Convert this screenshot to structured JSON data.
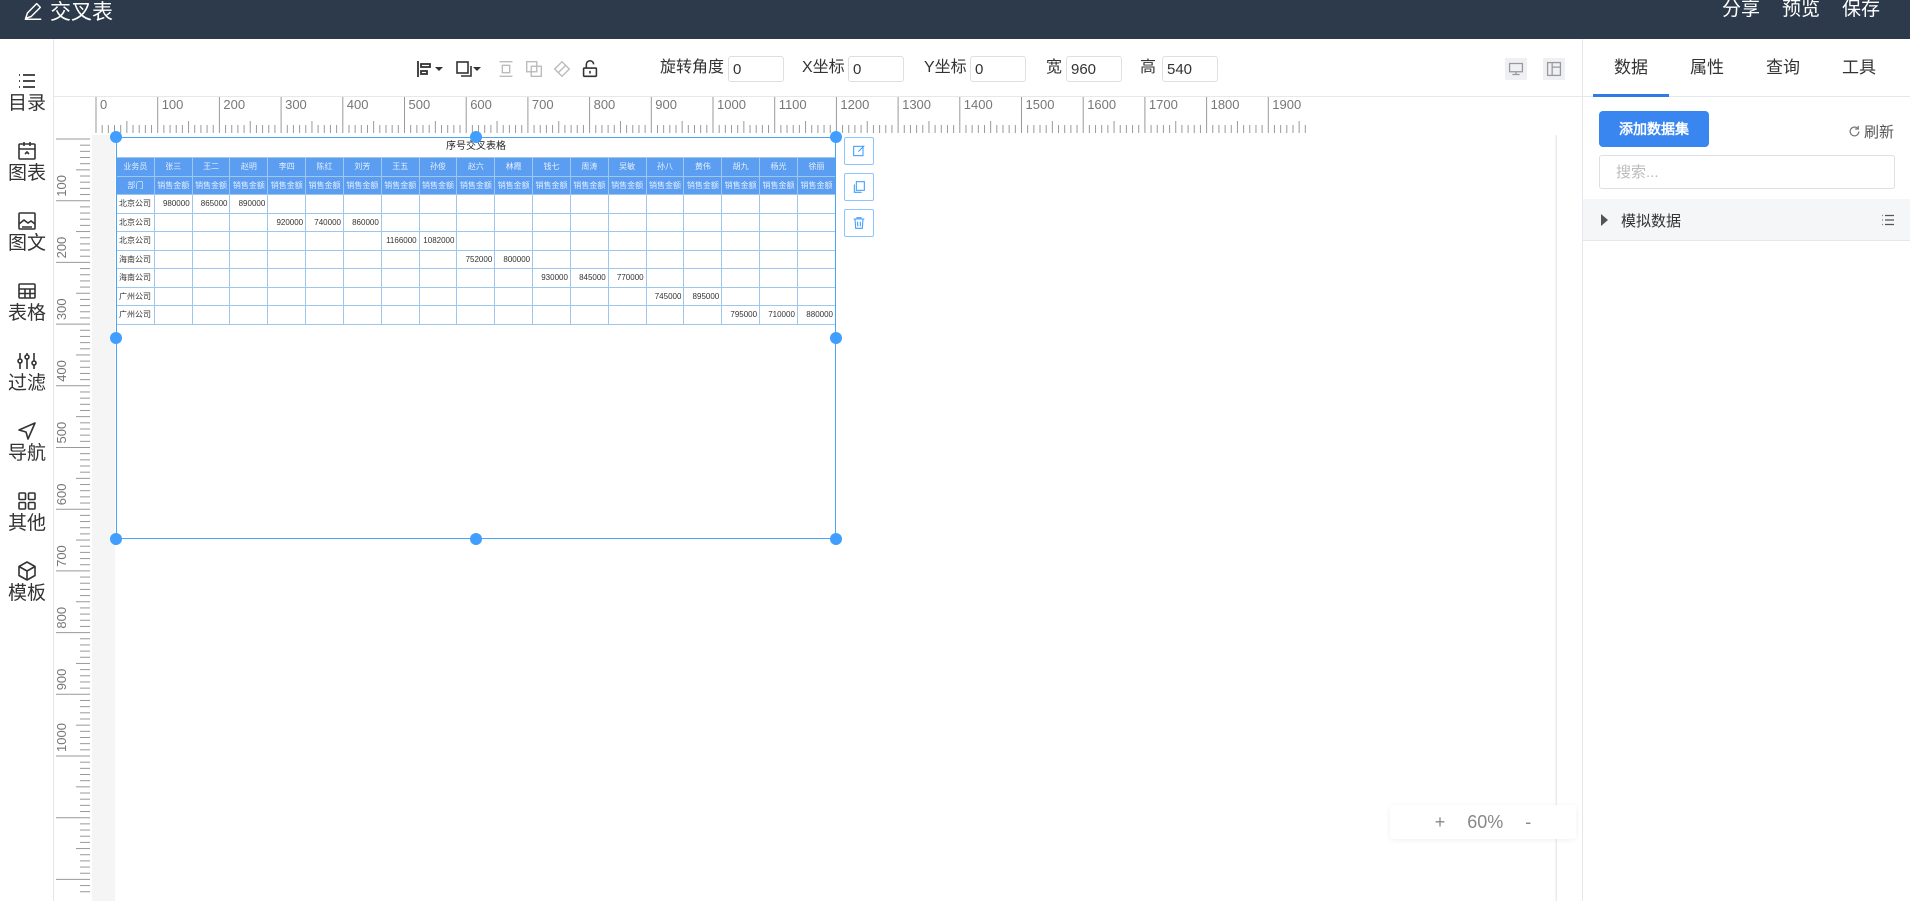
{
  "app": {
    "title": "交叉表"
  },
  "topbar": {
    "actions": [
      "分享",
      "预览",
      "保存"
    ]
  },
  "leftbar": {
    "items": [
      {
        "label": "目录",
        "icon": "list-icon"
      },
      {
        "label": "图表",
        "icon": "chart-icon"
      },
      {
        "label": "图文",
        "icon": "image-text-icon"
      },
      {
        "label": "表格",
        "icon": "table-icon"
      },
      {
        "label": "过滤",
        "icon": "filter-icon"
      },
      {
        "label": "导航",
        "icon": "navigation-icon"
      },
      {
        "label": "其他",
        "icon": "grid-apps-icon"
      },
      {
        "label": "模板",
        "icon": "template-icon"
      }
    ]
  },
  "toolbar": {
    "rotate_label": "旋转角度",
    "rotate_value": "0",
    "x_label": "X坐标",
    "x_value": "0",
    "y_label": "Y坐标",
    "y_value": "0",
    "w_label": "宽",
    "w_value": "960",
    "h_label": "高",
    "h_value": "540"
  },
  "rulers": {
    "h_labels": [
      "0",
      "100",
      "200",
      "300",
      "400",
      "500",
      "600",
      "700",
      "800",
      "900",
      "1000",
      "1100",
      "1200",
      "1300",
      "1400",
      "1500",
      "1600",
      "1700",
      "1800",
      "1900"
    ],
    "v_labels": [
      "100",
      "200",
      "300",
      "400",
      "500",
      "600",
      "700",
      "800",
      "900",
      "1000"
    ]
  },
  "table": {
    "title": "序号交叉表格",
    "header1": [
      "业务员",
      "张三",
      "王二",
      "赵明",
      "李四",
      "陈红",
      "刘芳",
      "王五",
      "孙俊",
      "赵六",
      "林霞",
      "钱七",
      "周涛",
      "吴敏",
      "孙八",
      "黄伟",
      "胡九",
      "杨光",
      "徐丽"
    ],
    "header2": [
      "部门",
      "销售金额",
      "销售金额",
      "销售金额",
      "销售金额",
      "销售金额",
      "销售金额",
      "销售金额",
      "销售金额",
      "销售金额",
      "销售金额",
      "销售金额",
      "销售金额",
      "销售金额",
      "销售金额",
      "销售金额",
      "销售金额",
      "销售金额",
      "销售金额"
    ],
    "rows": [
      [
        "北京公司",
        "980000",
        "865000",
        "890000",
        "",
        "",
        "",
        "",
        "",
        "",
        "",
        "",
        "",
        "",
        "",
        "",
        "",
        "",
        ""
      ],
      [
        "北京公司",
        "",
        "",
        "",
        "920000",
        "740000",
        "860000",
        "",
        "",
        "",
        "",
        "",
        "",
        "",
        "",
        "",
        "",
        "",
        ""
      ],
      [
        "北京公司",
        "",
        "",
        "",
        "",
        "",
        "",
        "1166000",
        "1082000",
        "",
        "",
        "",
        "",
        "",
        "",
        "",
        "",
        "",
        ""
      ],
      [
        "海南公司",
        "",
        "",
        "",
        "",
        "",
        "",
        "",
        "",
        "752000",
        "800000",
        "",
        "",
        "",
        "",
        "",
        "",
        "",
        ""
      ],
      [
        "海南公司",
        "",
        "",
        "",
        "",
        "",
        "",
        "",
        "",
        "",
        "",
        "930000",
        "845000",
        "770000",
        "",
        "",
        "",
        "",
        ""
      ],
      [
        "广州公司",
        "",
        "",
        "",
        "",
        "",
        "",
        "",
        "",
        "",
        "",
        "",
        "",
        "",
        "745000",
        "895000",
        "",
        "",
        ""
      ],
      [
        "广州公司",
        "",
        "",
        "",
        "",
        "",
        "",
        "",
        "",
        "",
        "",
        "",
        "",
        "",
        "",
        "",
        "795000",
        "710000",
        "880000"
      ]
    ]
  },
  "zoom": {
    "plus": "+",
    "value": "60%",
    "minus": "-"
  },
  "rightpanel": {
    "tabs": [
      "数据",
      "属性",
      "查询",
      "工具"
    ],
    "active_tab": "数据",
    "add_button": "添加数据集",
    "refresh": "刷新",
    "search_placeholder": "搜索...",
    "dataset": "模拟数据"
  },
  "colors": {
    "topbar": "#2d3a4b",
    "accent": "#3a86f0",
    "table_header": "#5b9df0",
    "selection": "#409eff"
  }
}
